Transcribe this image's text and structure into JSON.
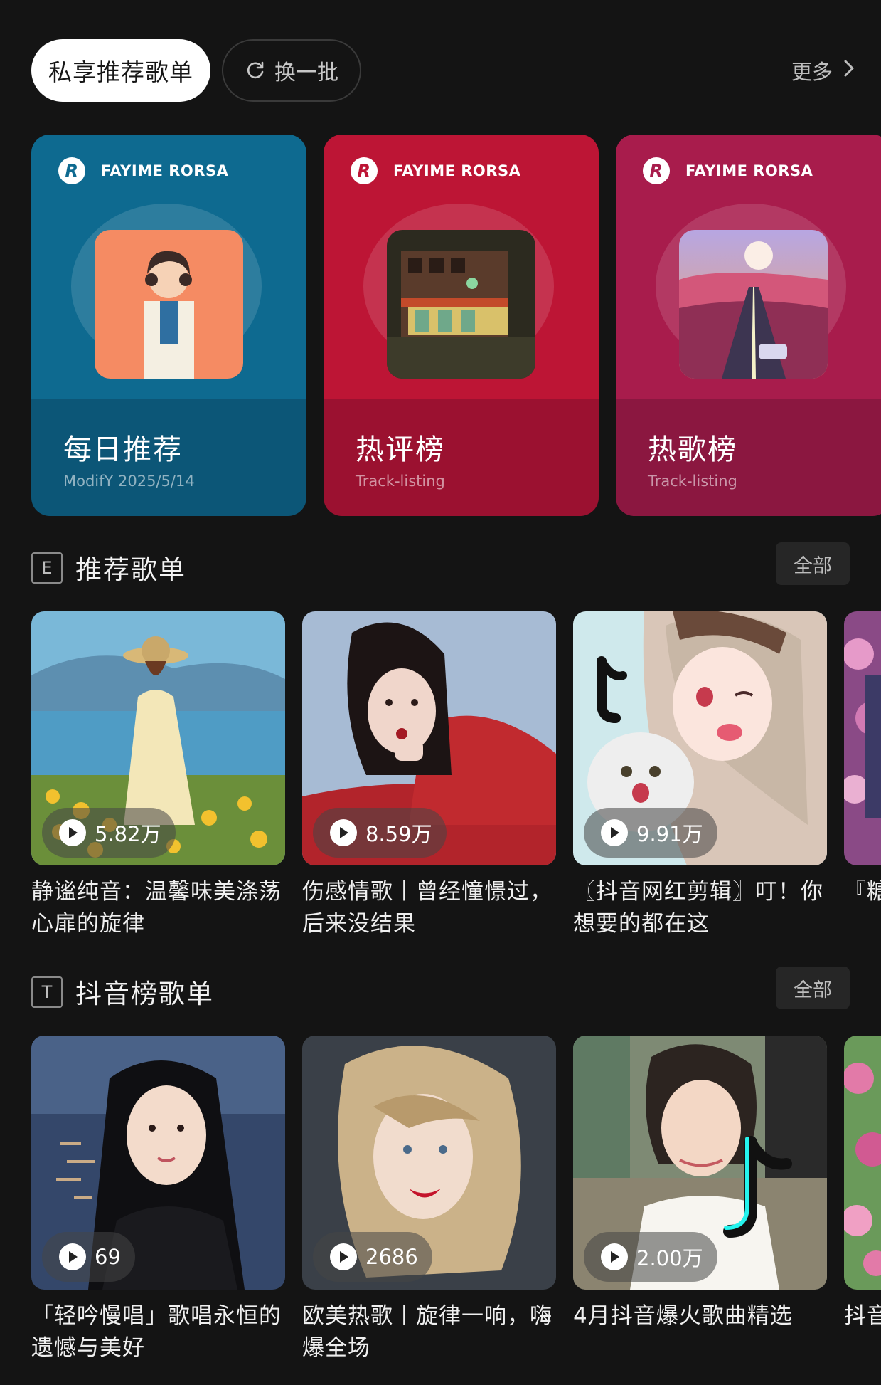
{
  "top_bar": {
    "primary_chip": "私享推荐歌单",
    "refresh_chip": "换一批",
    "more_label": "更多"
  },
  "feature_cards": [
    {
      "brand": "FAYIME RORSA",
      "title": "每日推荐",
      "subtitle": "ModifY  2025/5/14",
      "color_top": "#0e6a90",
      "color_bottom": "#0c5677"
    },
    {
      "brand": "FAYIME RORSA",
      "title": "热评榜",
      "subtitle": "Track-listing",
      "color_top": "#bd1535",
      "color_bottom": "#9b1130"
    },
    {
      "brand": "FAYIME RORSA",
      "title": "热歌榜",
      "subtitle": "Track-listing",
      "color_top": "#a81c4c",
      "color_bottom": "#8b1740"
    }
  ],
  "section_recommended": {
    "badge": "E",
    "title": "推荐歌单",
    "all_label": "全部",
    "playlists": [
      {
        "count": "5.82万",
        "title": "静谧纯音：温馨味美涤荡心扉的旋律"
      },
      {
        "count": "8.59万",
        "title": "伤感情歌丨曾经憧憬过，后来没结果"
      },
      {
        "count": "9.91万",
        "title": "〖抖音网红剪辑〗叮！你想要的都在这"
      },
      {
        "count": "",
        "title": "『糖青，"
      }
    ]
  },
  "section_douyin": {
    "badge": "T",
    "title": "抖音榜歌单",
    "all_label": "全部",
    "playlists": [
      {
        "count": "69",
        "title": "「轻吟慢唱」歌唱永恒的遗憾与美好"
      },
      {
        "count": "2686",
        "title": "欧美热歌丨旋律一响，嗨爆全场"
      },
      {
        "count": "2.00万",
        "title": "4月抖音爆火歌曲精选"
      },
      {
        "count": "",
        "title": "抖音小山"
      }
    ]
  },
  "icons": {
    "refresh": "refresh-icon",
    "chevron": "chevron-right-icon",
    "play": "play-icon",
    "brand": "brand-logo-icon"
  }
}
